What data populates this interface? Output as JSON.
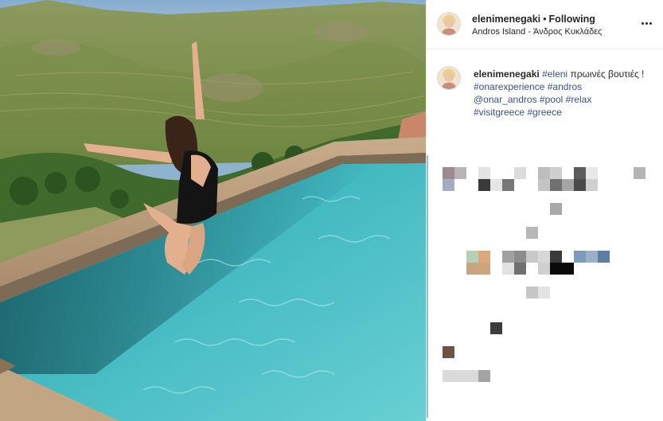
{
  "post": {
    "username": "elenimenegaki",
    "separator": "•",
    "follow_state": "Following",
    "location": "Andros Island - Άνδρος Κυκλάδες"
  },
  "caption": {
    "username": "elenimenegaki",
    "mention_tag": "#eleni",
    "text": "πρωινές βουτιές !",
    "tags": [
      "#onarexperience",
      "#andros",
      "@onar_andros",
      "#pool",
      "#relax",
      "#visitgreece",
      "#greece"
    ]
  },
  "icons": {
    "avatar": "profile-photo-icon",
    "more": "more-options-icon"
  },
  "colors": {
    "link": "#385185",
    "text": "#262626",
    "divider": "#efefef",
    "pool": "#3fb0b8",
    "sky": "#8fb3cf"
  }
}
